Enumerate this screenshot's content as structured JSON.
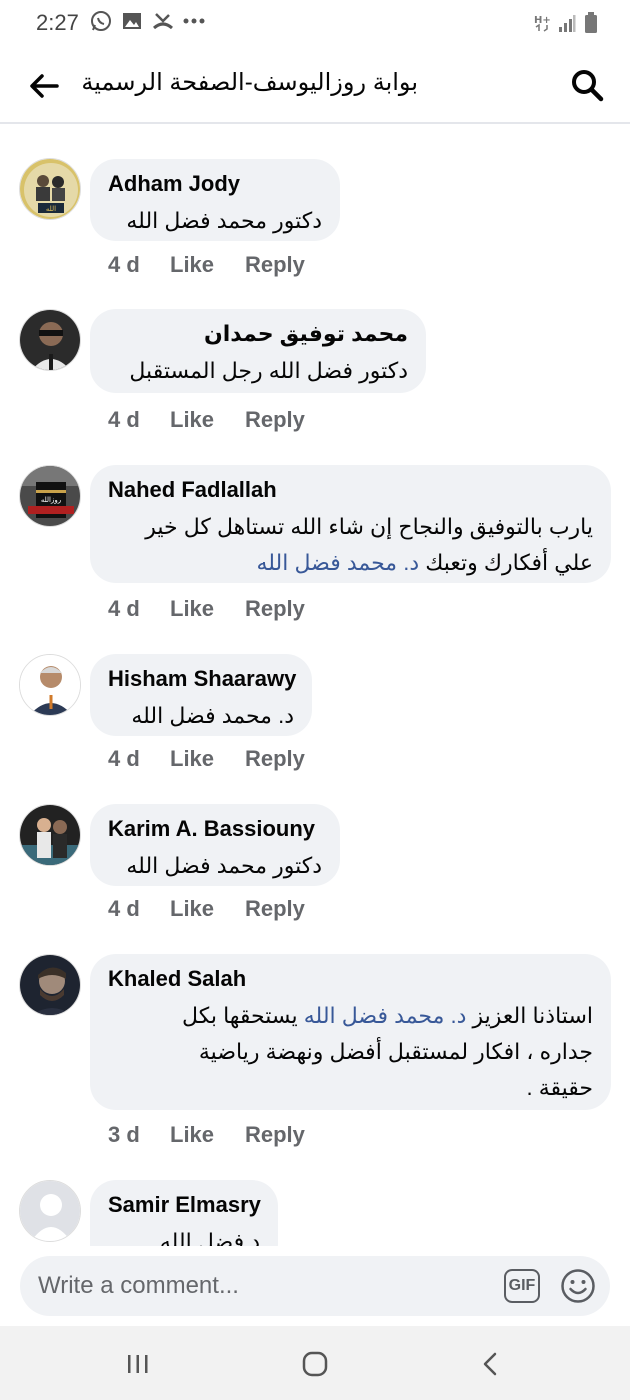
{
  "status_bar": {
    "time": "2:27",
    "left_icons": [
      "whatsapp-icon",
      "gallery-icon",
      "missed-call-icon",
      "more-dots-icon"
    ],
    "right_icons": [
      "network-hplus-icon",
      "signal-icon",
      "battery-icon"
    ]
  },
  "header": {
    "title": "بوابة روزاليوسف-الصفحة الرسمية",
    "back_icon": "back-arrow-icon",
    "search_icon": "search-icon"
  },
  "comments": [
    {
      "author": "Adham Jody",
      "lines": [
        "دكتور محمد فضل الله"
      ],
      "time": "4 d"
    },
    {
      "author": "محمد توفيق حمدان",
      "lines": [
        "دكتور فضل الله رجل المستقبل"
      ],
      "time": "4 d"
    },
    {
      "author": "Nahed Fadlallah",
      "lines": [
        "يارب بالتوفيق والنجاح إن شاء الله تستاهل كل خير"
      ],
      "line2_text": "علي أفكارك وتعبك ",
      "line2_mention": "د. محمد فضل الله",
      "time": "4 d"
    },
    {
      "author": "Hisham Shaarawy",
      "lines": [
        "د. محمد فضل الله"
      ],
      "time": "4 d"
    },
    {
      "author": "Karim A. Bassiouny",
      "lines": [
        "دكتور محمد فضل الله"
      ],
      "time": "4 d"
    },
    {
      "author": "Khaled Salah",
      "line1_text": "استاذنا العزيز ",
      "line1_mention": "د. محمد فضل الله",
      "line1_tail": " يستحقها بكل",
      "lines": [
        "جداره ، افكار لمستقبل أفضل ونهضة رياضية",
        "حقيقة ."
      ],
      "time": "3 d"
    },
    {
      "author": "Samir Elmasry",
      "lines": [
        "د فضل الله"
      ],
      "time": ""
    }
  ],
  "actions": {
    "like": "Like",
    "reply": "Reply"
  },
  "composer": {
    "placeholder": "Write a comment...",
    "gif_label": "GIF"
  },
  "colors": {
    "mention": "#385898",
    "bubble": "#f0f2f5",
    "meta": "#65676b"
  }
}
